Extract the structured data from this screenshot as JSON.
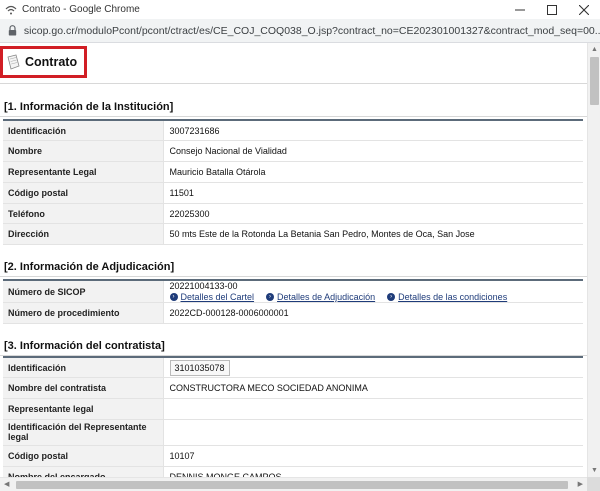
{
  "window": {
    "title": "Contrato - Google Chrome",
    "url": "sicop.go.cr/moduloPcont/pcont/ctract/es/CE_COJ_COQ038_O.jsp?contract_no=CE202301001327&contract_mod_seq=00..."
  },
  "page": {
    "title": "Contrato"
  },
  "section1": {
    "title": "[1. Información de la Institución]",
    "rows": [
      {
        "label": "Identificación",
        "value": "3007231686"
      },
      {
        "label": "Nombre",
        "value": "Consejo Nacional de Vialidad"
      },
      {
        "label": "Representante Legal",
        "value": "Mauricio Batalla Otárola"
      },
      {
        "label": "Código postal",
        "value": "11501"
      },
      {
        "label": "Teléfono",
        "value": "22025300"
      },
      {
        "label": "Dirección",
        "value": "50 mts Este de la Rotonda La Betania San Pedro, Montes de Oca, San Jose"
      }
    ]
  },
  "section2": {
    "title": "[2. Información de Adjudicación]",
    "sicop_label": "Número de SICOP",
    "sicop_value": "20221004133-00",
    "links": [
      "Detalles del Cartel",
      "Detalles de Adjudicación",
      "Detalles de las condiciones"
    ],
    "proc_label": "Número de procedimiento",
    "proc_value": "2022CD-000128-0006000001"
  },
  "section3": {
    "title": "[3. Información del contratista]",
    "rows": [
      {
        "label": "Identificación",
        "value": "3101035078"
      },
      {
        "label": "Nombre del contratista",
        "value": "CONSTRUCTORA MECO SOCIEDAD ANONIMA"
      },
      {
        "label": "Representante legal",
        "value": ""
      },
      {
        "label": "Identificación del Representante legal",
        "value": ""
      },
      {
        "label": "Código postal",
        "value": "10107"
      },
      {
        "label": "Nombre del encargado",
        "value": "DENNIS MONGE CAMPOS"
      }
    ]
  },
  "colors": {
    "header_border": "#d11e25",
    "table_top_border": "#5c6b7a",
    "link": "#1f3c7a",
    "label_bg": "#f2f2f2"
  }
}
